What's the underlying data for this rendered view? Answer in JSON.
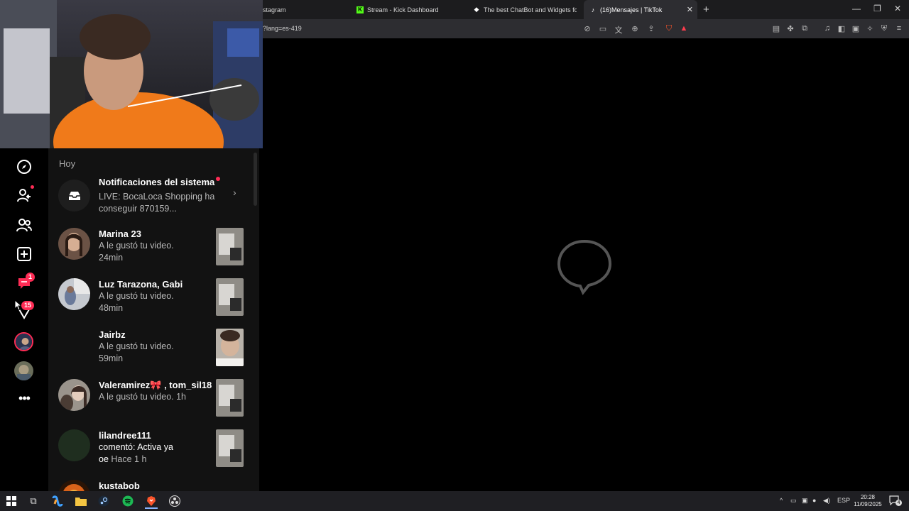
{
  "browser": {
    "tabs": [
      {
        "label": "stagram",
        "icon": "instagram-icon"
      },
      {
        "label": "Stream - Kick Dashboard",
        "icon": "kick-icon"
      },
      {
        "label": "The best ChatBot and Widgets for Ki",
        "icon": "botrix-icon"
      },
      {
        "label": "(16)Mensajes | TikTok",
        "icon": "tiktok-icon"
      }
    ],
    "url": "?lang=es-419"
  },
  "tiktok": {
    "nav_badges": {
      "messages": "1",
      "live": "15"
    },
    "section_header": "Hoy",
    "system": {
      "title": "Notificaciones del sistema",
      "preview": "LIVE: BocaLoca Shopping ha conseguir 870159..."
    },
    "notifications": [
      {
        "name": "Marina 23",
        "line1": "A le gustó tu video.",
        "line2": "24min"
      },
      {
        "name": "Luz Tarazona, Gabi",
        "line1": "A le gustó tu video.",
        "line2": "48min"
      },
      {
        "name": "Jairbz",
        "line1": "A le gustó tu video.",
        "line2": "59min"
      },
      {
        "name": "Valeramirez🎀 , tom_sil18",
        "line1": "A le gustó tu video. 1h",
        "line2": ""
      },
      {
        "name": "lilandree111",
        "line1": "comentó: Activa ya",
        "line2_main": "oe",
        "line2_time": "Hace 1 h"
      },
      {
        "name": "kustabob",
        "line1": "",
        "line2": ""
      }
    ]
  },
  "taskbar": {
    "lang": "ESP",
    "time": "20:28",
    "date": "11/09/2025",
    "notif_count": "4"
  }
}
